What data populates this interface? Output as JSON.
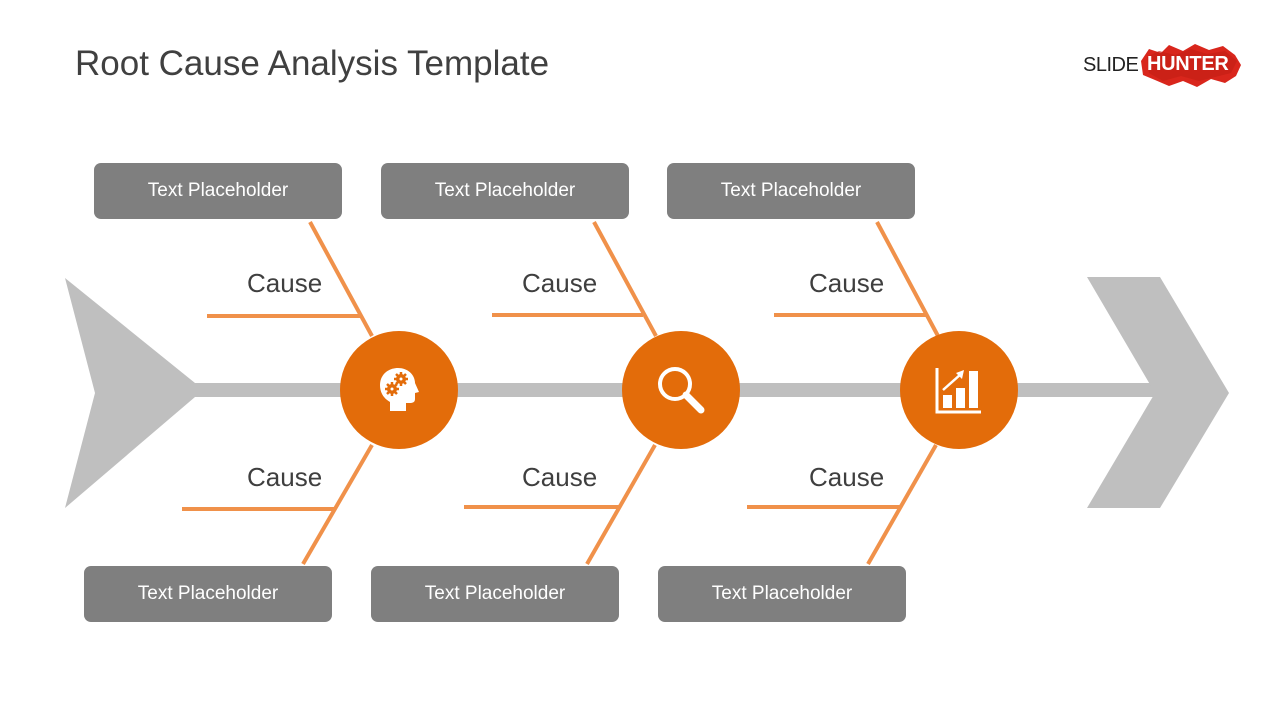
{
  "title": "Root Cause Analysis Template",
  "logo": {
    "left_text": "SLIDE",
    "right_text": "HUNTER",
    "accent": "#d9261c"
  },
  "colors": {
    "spine": "#bfbfbf",
    "bone": "#f0914a",
    "circle": "#e36c0a",
    "box": "#7f7f7f"
  },
  "branches": [
    {
      "icon": "head-gears-icon",
      "top_box": "Text Placeholder",
      "top_cause": "Cause",
      "bottom_cause": "Cause",
      "bottom_box": "Text Placeholder"
    },
    {
      "icon": "magnifier-icon",
      "top_box": "Text Placeholder",
      "top_cause": "Cause",
      "bottom_cause": "Cause",
      "bottom_box": "Text Placeholder"
    },
    {
      "icon": "growth-chart-icon",
      "top_box": "Text Placeholder",
      "top_cause": "Cause",
      "bottom_cause": "Cause",
      "bottom_box": "Text Placeholder"
    }
  ]
}
